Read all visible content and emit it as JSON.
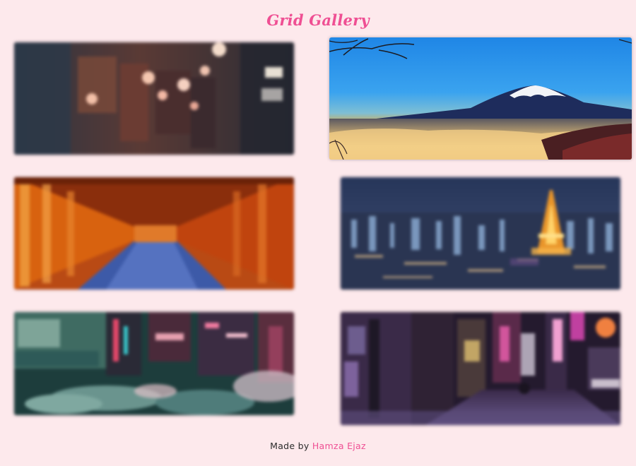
{
  "header": {
    "title": "Grid Gallery"
  },
  "gallery": {
    "photos": [
      {
        "subject": "lantern-alley-photo",
        "state": "blurred"
      },
      {
        "subject": "mount-fuji-photo",
        "state": "focused"
      },
      {
        "subject": "torii-gate-tunnel-photo",
        "state": "blurred"
      },
      {
        "subject": "tokyo-tower-night-photo",
        "state": "blurred"
      },
      {
        "subject": "neon-umbrellas-street-photo",
        "state": "blurred"
      },
      {
        "subject": "neon-night-alley-photo",
        "state": "blurred"
      }
    ]
  },
  "footer": {
    "prefix": "Made by ",
    "author": "Hamza Ejaz"
  },
  "colors": {
    "background": "#fde9ec",
    "accent": "#ef4f93",
    "text": "#2b2b2b"
  }
}
